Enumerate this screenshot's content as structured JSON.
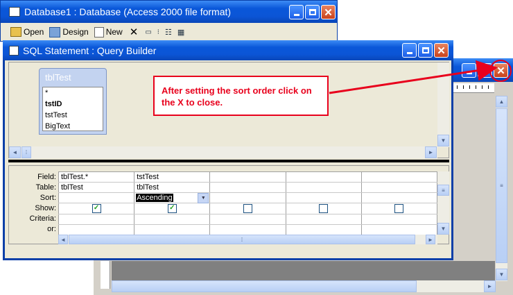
{
  "db_window": {
    "title": "Database1 : Database (Access 2000 file format)",
    "toolbar": {
      "open": "Open",
      "design": "Design",
      "new": "New"
    }
  },
  "qb_window": {
    "title": "SQL Statement : Query Builder",
    "table": {
      "name": "tblTest",
      "fields": [
        "*",
        "tstID",
        "tstTest",
        "BigText"
      ]
    },
    "grid": {
      "row_labels": [
        "Field:",
        "Table:",
        "Sort:",
        "Show:",
        "Criteria:",
        "or:"
      ],
      "columns": [
        {
          "field": "tblTest.*",
          "table": "tblTest",
          "sort": "",
          "show": true
        },
        {
          "field": "tstTest",
          "table": "tblTest",
          "sort": "Ascending",
          "show": true
        },
        {
          "field": "",
          "table": "",
          "sort": "",
          "show": false
        },
        {
          "field": "",
          "table": "",
          "sort": "",
          "show": false
        },
        {
          "field": "",
          "table": "",
          "sort": "",
          "show": false
        }
      ]
    }
  },
  "callout": {
    "text": "After setting the sort order click on the X to close.",
    "color": "#e8001c"
  }
}
